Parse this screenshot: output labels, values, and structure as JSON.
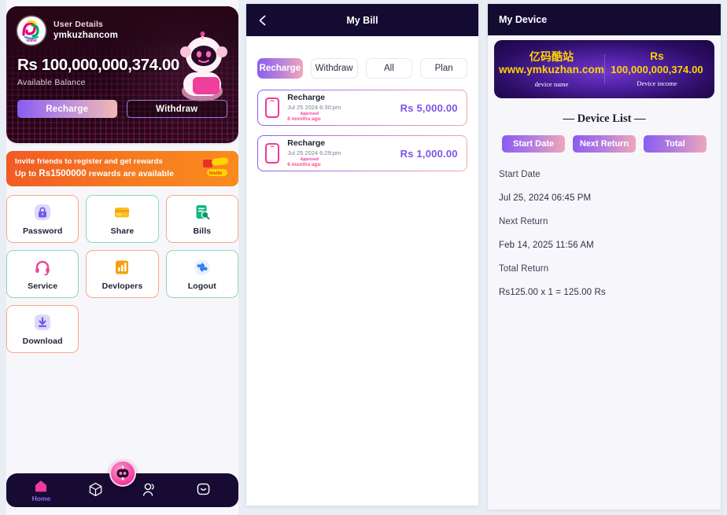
{
  "panel1": {
    "hero": {
      "user_title": "User Details",
      "user_name": "ymkuzhancom",
      "balance": "Rs 100,000,000,374.00",
      "balance_label": "Available Balance",
      "recharge_label": "Recharge",
      "withdraw_label": "Withdraw",
      "avatar_icon": "wallet-logo-icon",
      "mascot_icon": "robot-mascot-icon"
    },
    "invite": {
      "line1": "Invite friends to register and get rewards",
      "line2_prefix": "Up to ",
      "line2_amount": "Rs1500000",
      "line2_suffix": " rewards are available",
      "badge_label": "Invite",
      "badge_icon": "invite-ticket-icon"
    },
    "quick_actions": [
      {
        "label": "Password",
        "icon": "lock-icon",
        "border": "orange"
      },
      {
        "label": "Share",
        "icon": "card-icon",
        "border": "green"
      },
      {
        "label": "Bills",
        "icon": "bill-search-icon",
        "border": "orange"
      },
      {
        "label": "Service",
        "icon": "headset-icon",
        "border": "green"
      },
      {
        "label": "Devlopers",
        "icon": "chart-bar-icon",
        "border": "orange"
      },
      {
        "label": "Logout",
        "icon": "logout-icon",
        "border": "green"
      },
      {
        "label": "Download",
        "icon": "download-icon",
        "border": "orange"
      }
    ],
    "bottom_nav": [
      {
        "label": "Home",
        "icon": "home-icon",
        "active": true
      },
      {
        "label": "",
        "icon": "cube-icon",
        "active": false
      },
      {
        "label": "",
        "icon": "user-icon",
        "active": false
      },
      {
        "label": "",
        "icon": "chat-icon",
        "active": false
      }
    ],
    "fab_icon": "robot-chat-icon"
  },
  "panel2": {
    "topbar": {
      "title": "My Bill",
      "back_icon": "chevron-left-icon"
    },
    "filters": [
      {
        "label": "Recharge",
        "active": true
      },
      {
        "label": "Withdraw",
        "active": false
      },
      {
        "label": "All",
        "active": false
      },
      {
        "label": "Plan",
        "active": false
      }
    ],
    "transactions": [
      {
        "title": "Recharge",
        "date": "Jul 25 2024 6:30:pm",
        "status": "Approved",
        "ago": "6 months ago",
        "amount": "Rs 5,000.00",
        "icon": "phone-icon"
      },
      {
        "title": "Recharge",
        "date": "Jul 25 2024 6:29:pm",
        "status": "Approved",
        "ago": "6 months ago",
        "amount": "Rs 1,000.00",
        "icon": "phone-icon"
      }
    ]
  },
  "panel3": {
    "topbar": {
      "title": "My Device"
    },
    "device_card": {
      "name_cn": "亿码酷站",
      "name_url": "www.ymkuzhan.com",
      "name_caption": "device name",
      "income_currency": "Rs",
      "income_amount": "100,000,000,374.00",
      "income_caption": "Device income"
    },
    "device_list_title": "— Device List —",
    "pills": [
      {
        "label": "Start Date"
      },
      {
        "label": "Next Return"
      },
      {
        "label": "Total"
      }
    ],
    "details": [
      {
        "label": "Start Date",
        "value": "Jul 25, 2024 06:45 PM"
      },
      {
        "label": "Next Return",
        "value": "Feb 14, 2025 11:56 AM"
      },
      {
        "label": "Total Return",
        "value": "Rs125.00 x 1 = 125.00 Rs"
      }
    ]
  },
  "colors": {
    "accent_purple": "#8a5cf0",
    "accent_pink": "#f0399d",
    "navy": "#140b33",
    "orange": "#f15a24",
    "yellow": "#ffd400",
    "page_bg": "#e9edf4"
  }
}
